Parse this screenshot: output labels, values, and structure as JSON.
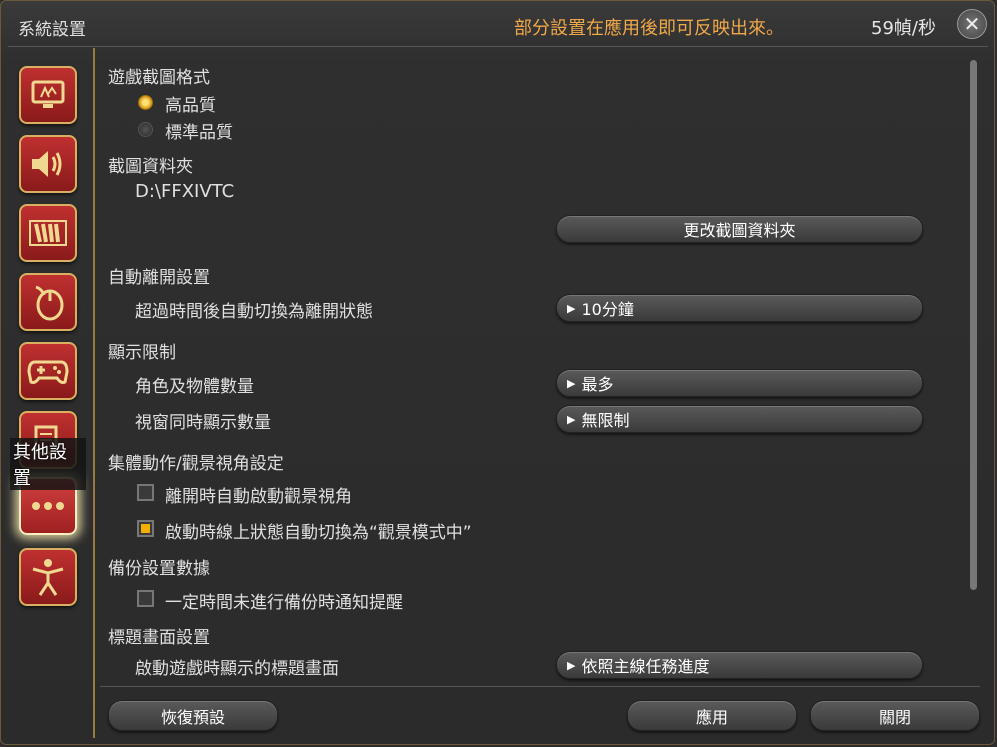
{
  "title": "系統設置",
  "notice": "部分設置在應用後即可反映出來。",
  "fps": "59幀/秒",
  "sidebar": {
    "tooltip": "其他設置",
    "icons": [
      "monitor-icon",
      "speaker-icon",
      "bars-icon",
      "mouse-icon",
      "gamepad-icon",
      "notepad-icon",
      "ellipsis-icon",
      "figure-icon"
    ]
  },
  "screenshot": {
    "heading": "遊戲截圖格式",
    "options": [
      "高品質",
      "標準品質"
    ],
    "selected": "高品質",
    "folder_heading": "截圖資料夾",
    "folder_path": "D:\\FFXIVTC",
    "change_button": "更改截圖資料夾"
  },
  "afk": {
    "heading": "自動離開設置",
    "label": "超過時間後自動切換為離開狀態",
    "value": "10分鐘"
  },
  "display_limit": {
    "heading": "顯示限制",
    "chars_label": "角色及物體數量",
    "chars_value": "最多",
    "windows_label": "視窗同時顯示數量",
    "windows_value": "無限制"
  },
  "group_pose": {
    "heading": "集體動作/觀景視角設定",
    "opt1": "離開時自動啟動觀景視角",
    "opt1_checked": false,
    "opt2": "啟動時線上狀態自動切換為“觀景模式中”",
    "opt2_checked": true
  },
  "backup": {
    "heading": "備份設置數據",
    "opt1": "一定時間未進行備份時通知提醒",
    "opt1_checked": false
  },
  "title_screen": {
    "heading": "標題畫面設置",
    "label": "啟動遊戲時顯示的標題畫面",
    "value": "依照主線任務進度"
  },
  "footer": {
    "reset": "恢復預設",
    "apply": "應用",
    "close": "關閉"
  }
}
